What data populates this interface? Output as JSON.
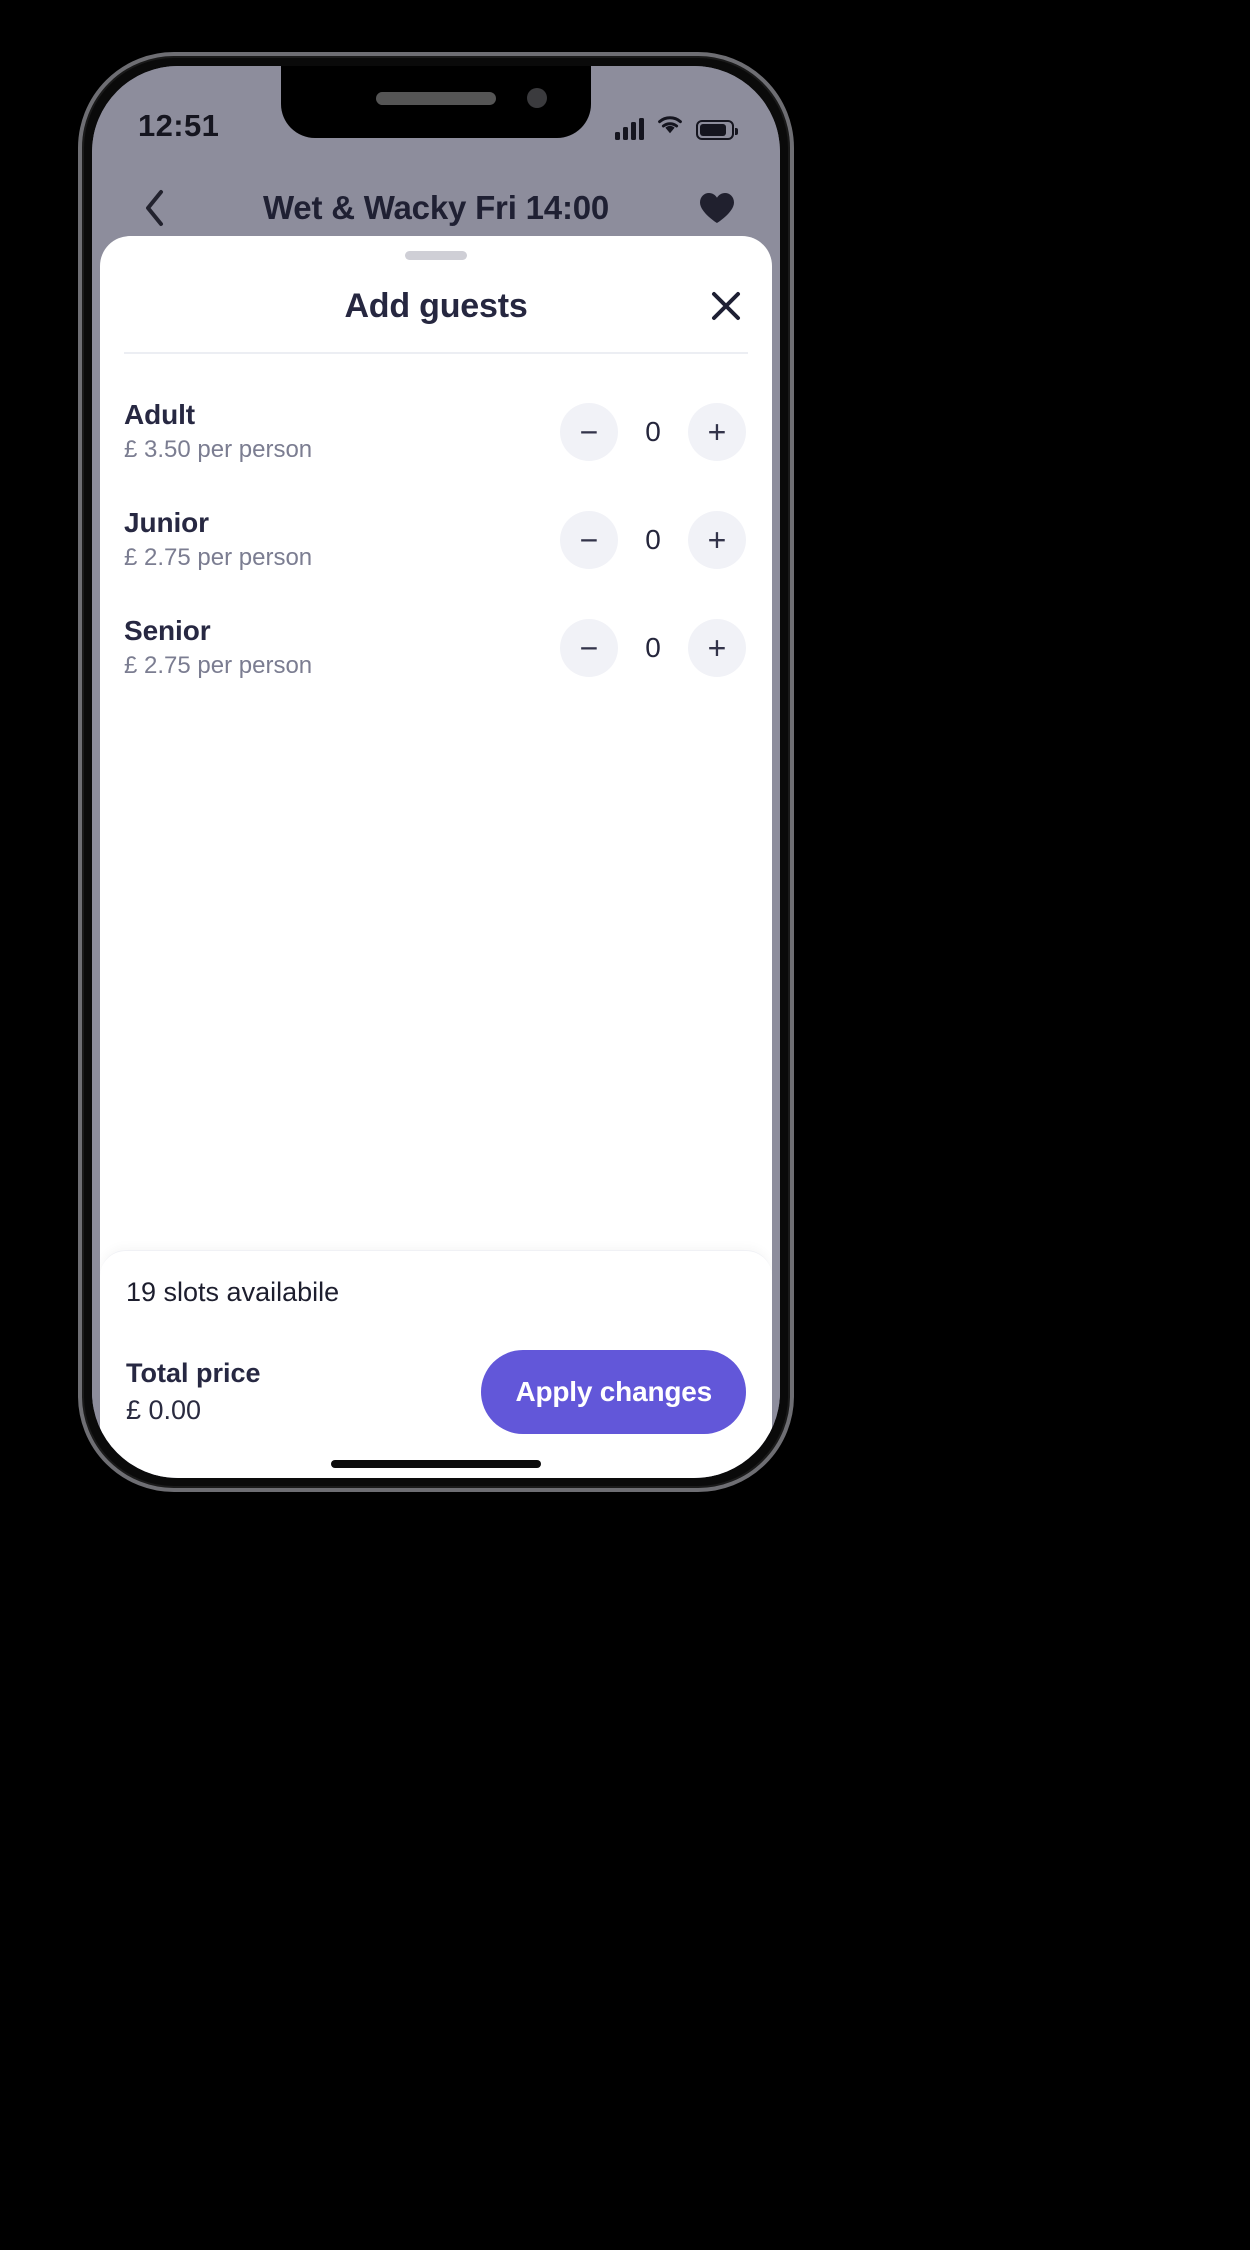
{
  "status_bar": {
    "time": "12:51",
    "signal_icon": "signal-bars-icon",
    "wifi_icon": "wifi-icon",
    "battery_icon": "battery-icon"
  },
  "app_nav": {
    "back_icon": "chevron-left-icon",
    "title": "Wet & Wacky Fri 14:00",
    "favourite_icon": "heart-filled-icon"
  },
  "sheet": {
    "handle": "drag-handle",
    "title": "Add guests",
    "close_icon": "close-x-icon",
    "guests": [
      {
        "name": "Adult",
        "price_label": "£ 3.50 per person",
        "count": "0",
        "decrement_label": "−",
        "increment_label": "+"
      },
      {
        "name": "Junior",
        "price_label": "£ 2.75 per person",
        "count": "0",
        "decrement_label": "−",
        "increment_label": "+"
      },
      {
        "name": "Senior",
        "price_label": "£ 2.75 per person",
        "count": "0",
        "decrement_label": "−",
        "increment_label": "+"
      }
    ],
    "footer": {
      "slots_text": "19 slots availabile",
      "total_label": "Total price",
      "total_value": "£  0.00",
      "apply_label": "Apply changes"
    }
  },
  "colors": {
    "accent": "#6257d9",
    "sheet_bg": "#ffffff",
    "dimmed_app_bg": "#8d8d9c",
    "text_dark": "#272842",
    "text_muted": "#7b7d91",
    "stepper_bg": "#f1f2f7"
  }
}
